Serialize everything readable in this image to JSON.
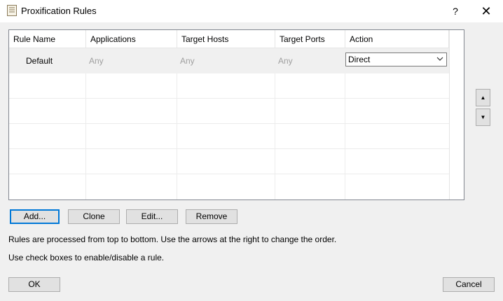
{
  "window": {
    "title": "Proxification Rules",
    "help": "?",
    "close": "✕"
  },
  "table": {
    "columns": [
      "Rule Name",
      "Applications",
      "Target Hosts",
      "Target Ports",
      "Action"
    ],
    "rows": [
      {
        "rule_name": "Default",
        "applications": "Any",
        "target_hosts": "Any",
        "target_ports": "Any",
        "action": "Direct"
      }
    ]
  },
  "buttons": {
    "add": "Add...",
    "clone": "Clone",
    "edit": "Edit...",
    "remove": "Remove",
    "ok": "OK",
    "cancel": "Cancel",
    "move_up": "▲",
    "move_down": "▼"
  },
  "info": {
    "line1": "Rules are processed from top to bottom. Use the arrows at the right to change the order.",
    "line2": "Use check boxes to enable/disable a rule."
  }
}
